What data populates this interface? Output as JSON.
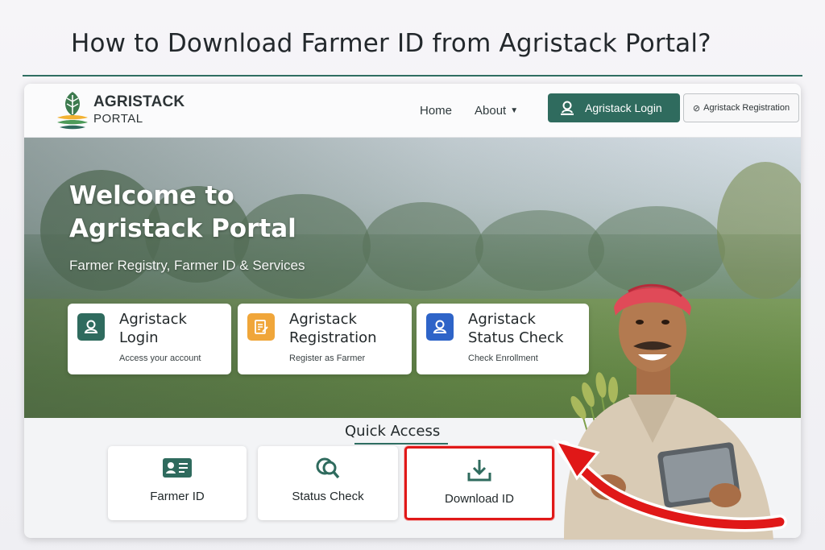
{
  "page_heading": "How to Download Farmer ID from Agristack Portal?",
  "colors": {
    "primary": "#2f6b5e",
    "highlight": "#e01818",
    "registration_icon": "#f0a63a",
    "status_icon": "#2e64c8"
  },
  "header": {
    "brand_name": "AGRISTACK",
    "brand_sub": "PORTAL",
    "nav": {
      "home": "Home",
      "about": "About"
    },
    "login_button": "Agristack Login",
    "registration_button": "Agristack Registration"
  },
  "hero": {
    "title": "Welcome to Agristack Portal",
    "subtitle": "Farmer Registry, Farmer ID & Services",
    "cards": [
      {
        "title": "Agristack Login",
        "description": "Access your account",
        "icon": "user-icon"
      },
      {
        "title": "Agristack Registration",
        "description": "Register as Farmer",
        "icon": "form-edit-icon"
      },
      {
        "title": "Agristack Status Check",
        "description": "Check Enrollment",
        "icon": "user-icon"
      }
    ]
  },
  "quick_access": {
    "title": "Quick Access",
    "items": [
      {
        "label": "Farmer ID",
        "icon": "id-card-icon"
      },
      {
        "label": "Status Check",
        "icon": "search-icon"
      },
      {
        "label": "Download ID",
        "icon": "download-icon"
      }
    ]
  }
}
